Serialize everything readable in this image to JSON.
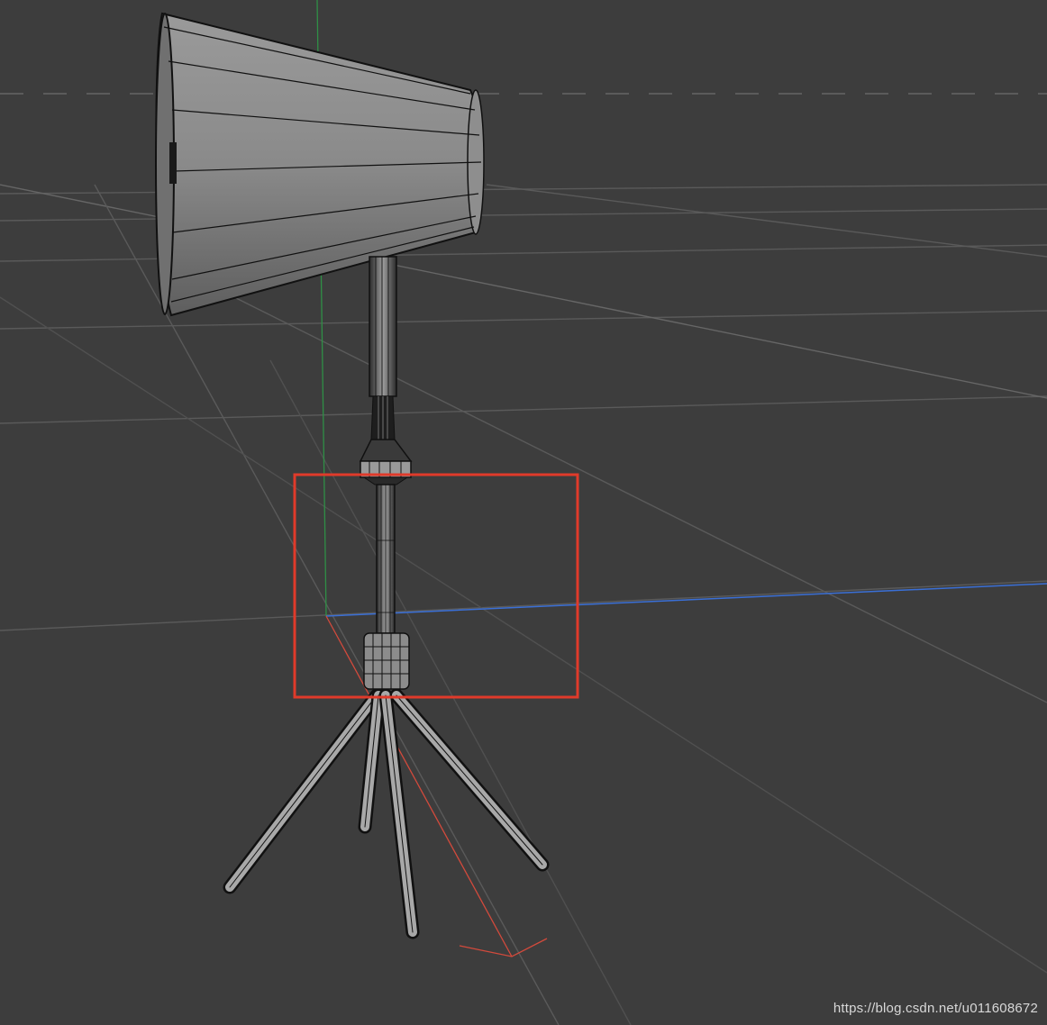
{
  "viewport": {
    "background": "#3d3d3d",
    "grid_color": "#5a5a5a",
    "axes": {
      "x_color": "#d24a3c",
      "y_color": "#2f8f46",
      "z_color": "#3a6fd6"
    },
    "selection_box_color": "#e03a2a"
  },
  "model": {
    "name": "lamp",
    "wire_color": "#111111",
    "surface_color": "#8a8a8a"
  },
  "watermark": {
    "text": "https://blog.csdn.net/u011608672"
  }
}
